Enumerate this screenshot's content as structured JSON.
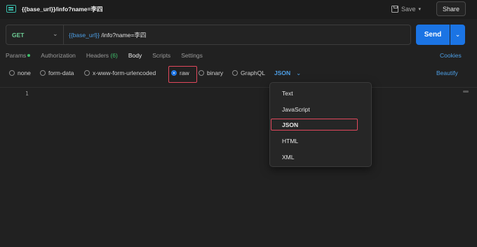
{
  "window": {
    "title": "{{base_url}}/info?name=李四",
    "save_label": "Save",
    "share_label": "Share"
  },
  "request": {
    "method": "GET",
    "url_variable": "{{base_url}}",
    "url_path": "/info?name=李四",
    "send_label": "Send"
  },
  "tabs": {
    "params": "Params",
    "authorization": "Authorization",
    "headers": "Headers",
    "headers_count": "(6)",
    "body": "Body",
    "scripts": "Scripts",
    "settings": "Settings",
    "cookies": "Cookies"
  },
  "body_types": {
    "none": "none",
    "form_data": "form-data",
    "urlencoded": "x-www-form-urlencoded",
    "raw": "raw",
    "binary": "binary",
    "graphql": "GraphQL",
    "selected": "raw",
    "format": "JSON",
    "beautify": "Beautify"
  },
  "editor": {
    "line_number": "1"
  },
  "format_menu": {
    "items": [
      "Text",
      "JavaScript",
      "JSON",
      "HTML",
      "XML"
    ],
    "selected": "JSON"
  },
  "colors": {
    "accent": "#1b74e4",
    "link": "#4d9fe6",
    "method_get": "#6fcf97",
    "highlight": "#e0485c",
    "background": "#212121"
  }
}
